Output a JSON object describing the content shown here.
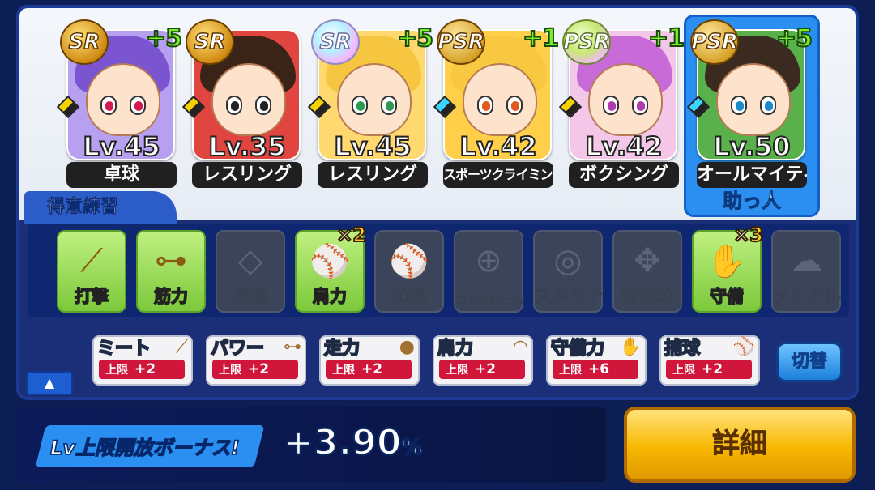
{
  "cards": [
    {
      "rarity": "SR",
      "bonus": "+5",
      "level": "Lv.45",
      "name": "卓球",
      "hair": "#7b55d0",
      "eye": "#d11a4d",
      "bg": "#b6a0ef"
    },
    {
      "rarity": "SR",
      "bonus": "",
      "level": "Lv.35",
      "name": "レスリング",
      "hair": "#3a2418",
      "eye": "#222",
      "bg": "#e04540"
    },
    {
      "rarity": "SR",
      "bonus": "+5",
      "level": "Lv.45",
      "name": "レスリング",
      "hair": "#f6c640",
      "eye": "#2f9a55",
      "bg": "#ffd870"
    },
    {
      "rarity": "PSR",
      "bonus": "+1",
      "level": "Lv.42",
      "name": "スポーツクライミング",
      "hair": "#f8c840",
      "eye": "#e05a20",
      "bg": "#ffcf4a"
    },
    {
      "rarity": "PSR",
      "bonus": "+1",
      "level": "Lv.42",
      "name": "ボクシング",
      "hair": "#c86ad8",
      "eye": "#b03ab0",
      "bg": "#f4c6e8"
    },
    {
      "rarity": "PSR",
      "bonus": "+5",
      "level": "Lv.50",
      "name": "オールマイティ",
      "hair": "#3a2a20",
      "eye": "#1a8ac8",
      "bg": "#5ab04a"
    }
  ],
  "helper_label": "助っ人",
  "special_practice_title": "得意練習",
  "practices": [
    {
      "label": "打撃",
      "active": true,
      "icon": "bat-icon",
      "glyph": "⟋",
      "multiplier": ""
    },
    {
      "label": "筋力",
      "active": true,
      "icon": "dumbbell-icon",
      "glyph": "⊶",
      "multiplier": ""
    },
    {
      "label": "走塁",
      "active": false,
      "icon": "base-icon",
      "glyph": "◇",
      "multiplier": ""
    },
    {
      "label": "肩力",
      "active": true,
      "icon": "baseball-throw-icon",
      "glyph": "⚾",
      "multiplier": "2"
    },
    {
      "label": "球速",
      "active": false,
      "icon": "fastball-icon",
      "glyph": "⚾",
      "multiplier": ""
    },
    {
      "label": "コントロール",
      "active": false,
      "icon": "target-icon",
      "glyph": "⊕",
      "multiplier": ""
    },
    {
      "label": "スタミナ",
      "active": false,
      "icon": "tire-icon",
      "glyph": "◎",
      "multiplier": ""
    },
    {
      "label": "変化球",
      "active": false,
      "icon": "breaking-ball-icon",
      "glyph": "✥",
      "multiplier": ""
    },
    {
      "label": "守備",
      "active": true,
      "icon": "glove-icon",
      "glyph": "✋",
      "multiplier": "3"
    },
    {
      "label": "メンタル",
      "active": false,
      "icon": "mental-cloud-icon",
      "glyph": "☁",
      "multiplier": ""
    }
  ],
  "stat_cap_label": "上限",
  "stats": [
    {
      "name": "ミート",
      "value": "+2",
      "icon": "bat-icon",
      "glyph": "⟋"
    },
    {
      "name": "パワー",
      "value": "+2",
      "icon": "dumbbell-icon",
      "glyph": "⊶"
    },
    {
      "name": "走力",
      "value": "+2",
      "icon": "runner-icon",
      "glyph": "●"
    },
    {
      "name": "肩力",
      "value": "+2",
      "icon": "throw-arc-icon",
      "glyph": "◠"
    },
    {
      "name": "守備力",
      "value": "+6",
      "icon": "glove-icon",
      "glyph": "✋"
    },
    {
      "name": "捕球",
      "value": "+2",
      "icon": "catch-icon",
      "glyph": "⚾"
    }
  ],
  "switch_label": "切替",
  "collapse_glyph": "▲",
  "bonus_title": "Lv上限開放ボーナス!",
  "bonus_sign": "+",
  "bonus_value": "3.90",
  "bonus_unit": "%",
  "detail_label": "詳細",
  "colors": {
    "accent_blue": "#2a8ff0",
    "cap_red": "#d0163b",
    "detail_yellow": "#f7b700",
    "active_green": "#7cc93b"
  }
}
